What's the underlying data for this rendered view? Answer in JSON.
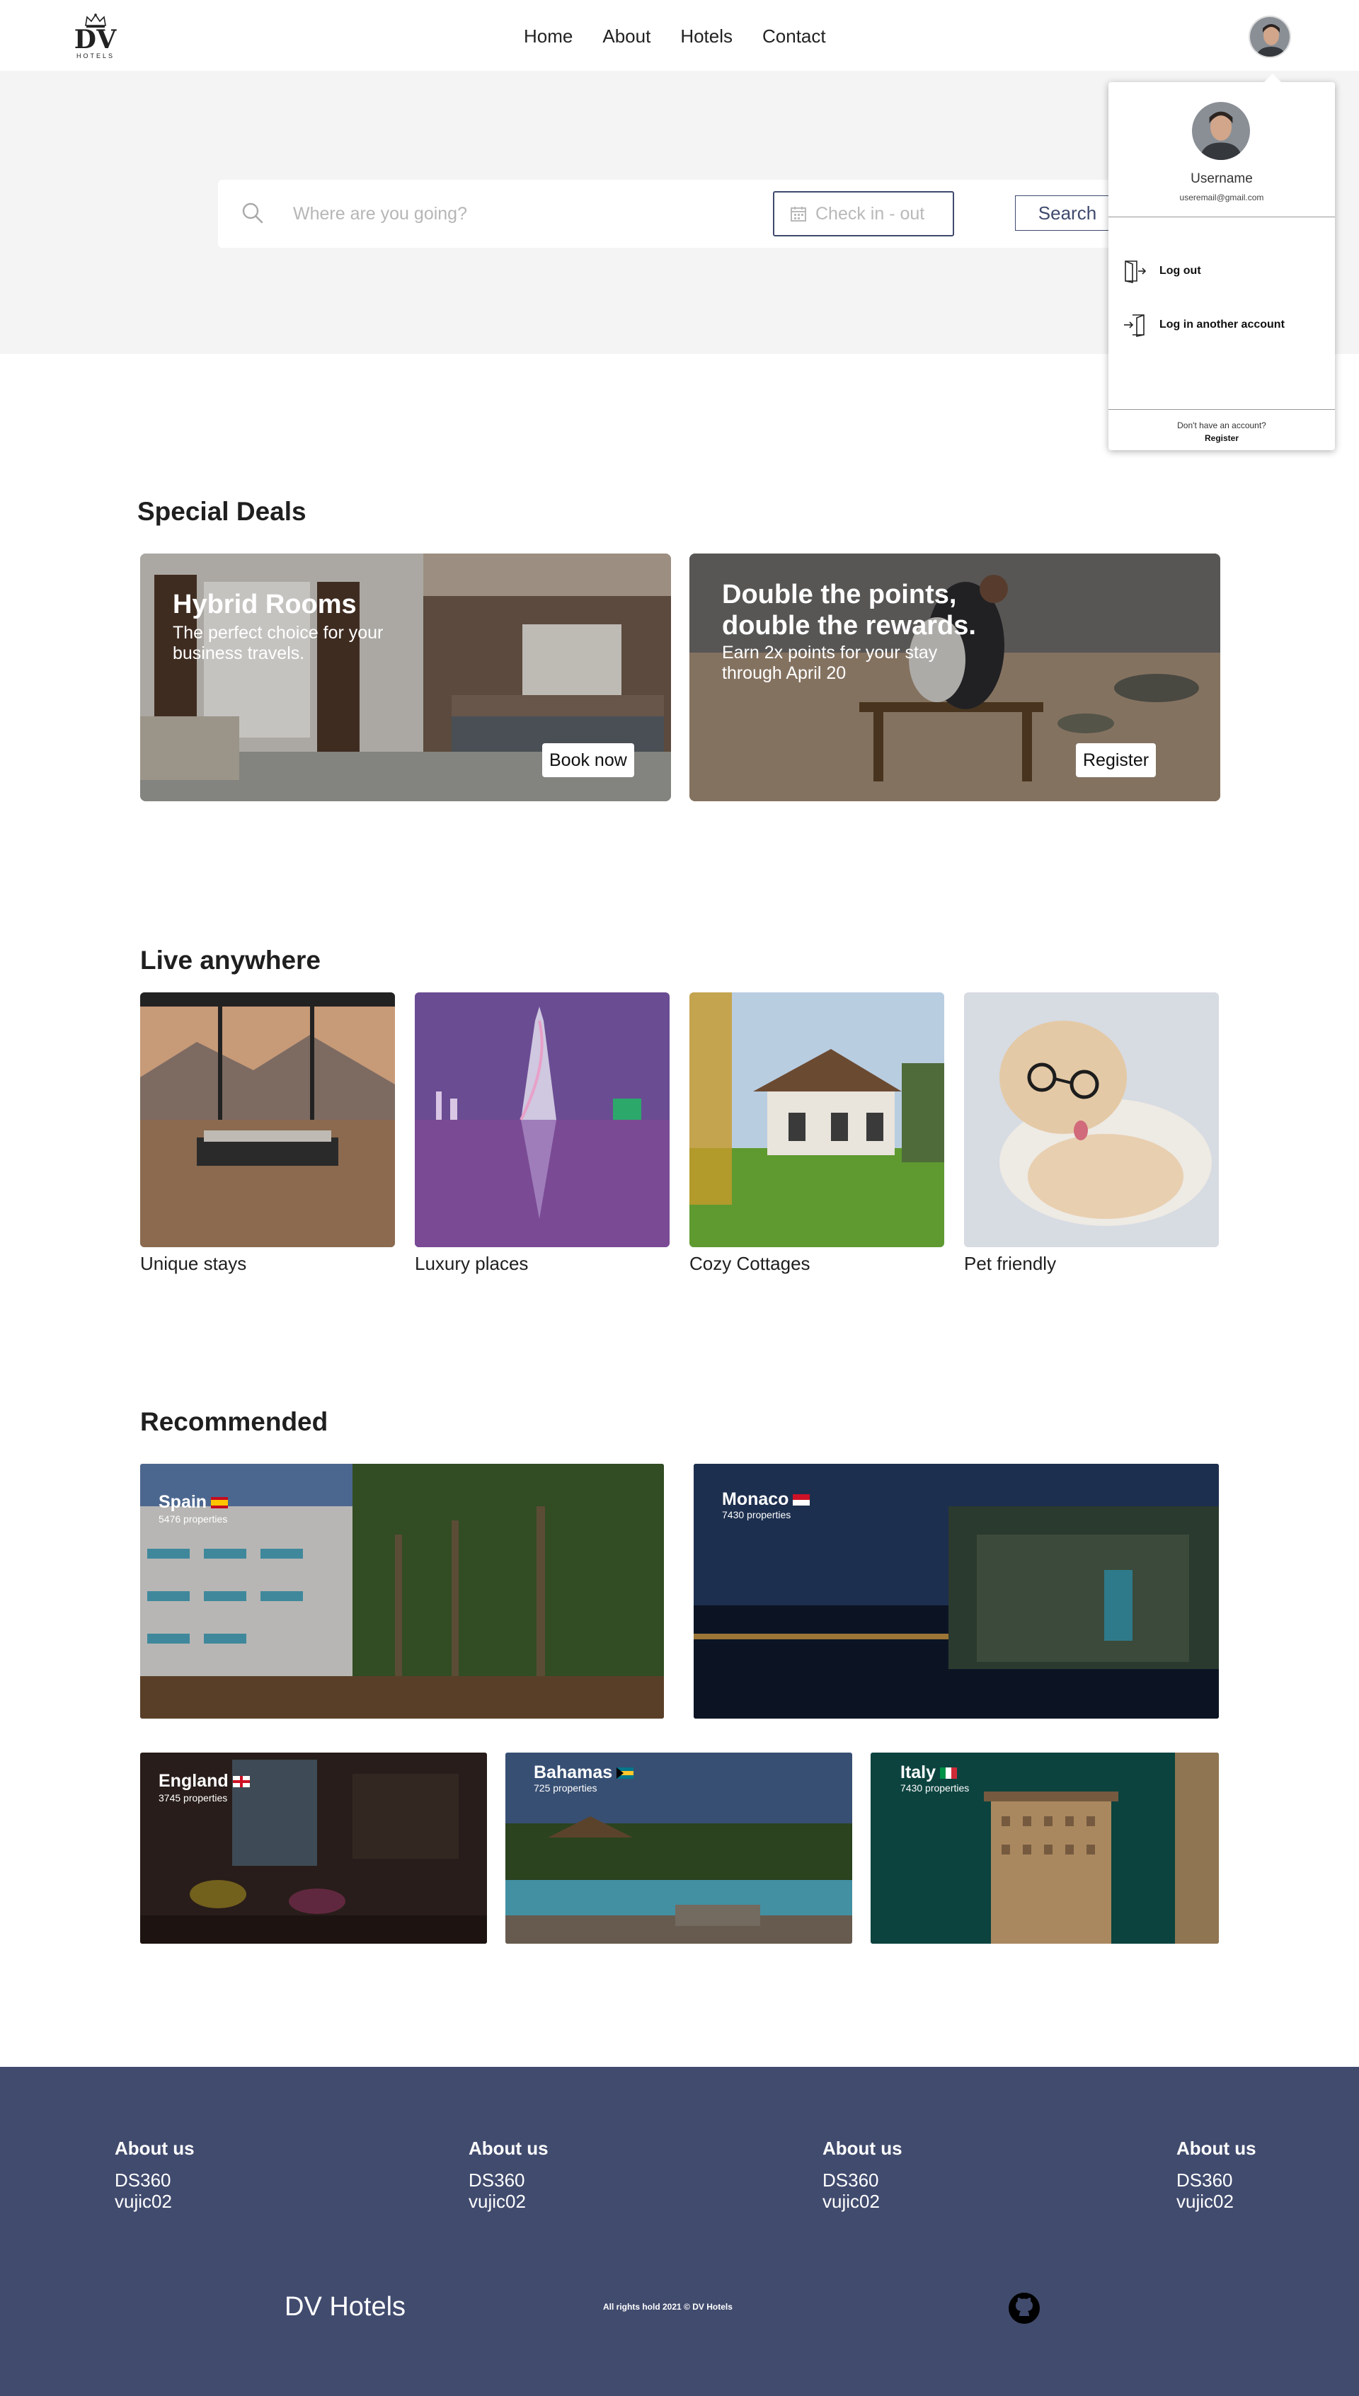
{
  "nav": {
    "logo_text": "DV",
    "logo_sub": "HOTELS",
    "items": [
      "Home",
      "About",
      "Hotels",
      "Contact"
    ]
  },
  "search": {
    "placeholder": "Where are you going?",
    "checkin_placeholder": "Check in - out",
    "button_label": "Search"
  },
  "account_menu": {
    "username": "Username",
    "email": "useremail@gmail.com",
    "logout_label": "Log out",
    "another_account_label": "Log in another account",
    "no_account_text": "Don't have an account?",
    "register_label": "Register"
  },
  "special_deals": {
    "heading": "Special Deals",
    "cards": [
      {
        "title": "Hybrid Rooms",
        "description": "The perfect choice for your business travels.",
        "button": "Book now"
      },
      {
        "title": "Double the points, double the rewards.",
        "description": "Earn 2x points for your stay through April 20",
        "button": "Register"
      }
    ]
  },
  "live_anywhere": {
    "heading": "Live anywhere",
    "items": [
      "Unique stays",
      "Luxury places",
      "Cozy Cottages",
      "Pet friendly"
    ]
  },
  "recommended": {
    "heading": "Recommended",
    "places": [
      {
        "name": "Spain",
        "properties": "5476 properties"
      },
      {
        "name": "Monaco",
        "properties": "7430 properties"
      },
      {
        "name": "England",
        "properties": "3745 properties"
      },
      {
        "name": "Bahamas",
        "properties": "725 properties"
      },
      {
        "name": "Italy",
        "properties": "7430 properties"
      }
    ]
  },
  "footer": {
    "columns": [
      {
        "heading": "About us",
        "links": [
          "DS360",
          "vujic02"
        ]
      },
      {
        "heading": "About us",
        "links": [
          "DS360",
          "vujic02"
        ]
      },
      {
        "heading": "About us",
        "links": [
          "DS360",
          "vujic02"
        ]
      },
      {
        "heading": "About us",
        "links": [
          "DS360",
          "vujic02"
        ]
      }
    ],
    "brand": "DV Hotels",
    "rights": "All rights hold 2021 © DV Hotels"
  },
  "colors": {
    "accent": "#414b6e",
    "hero_bg": "#f4f4f4"
  }
}
